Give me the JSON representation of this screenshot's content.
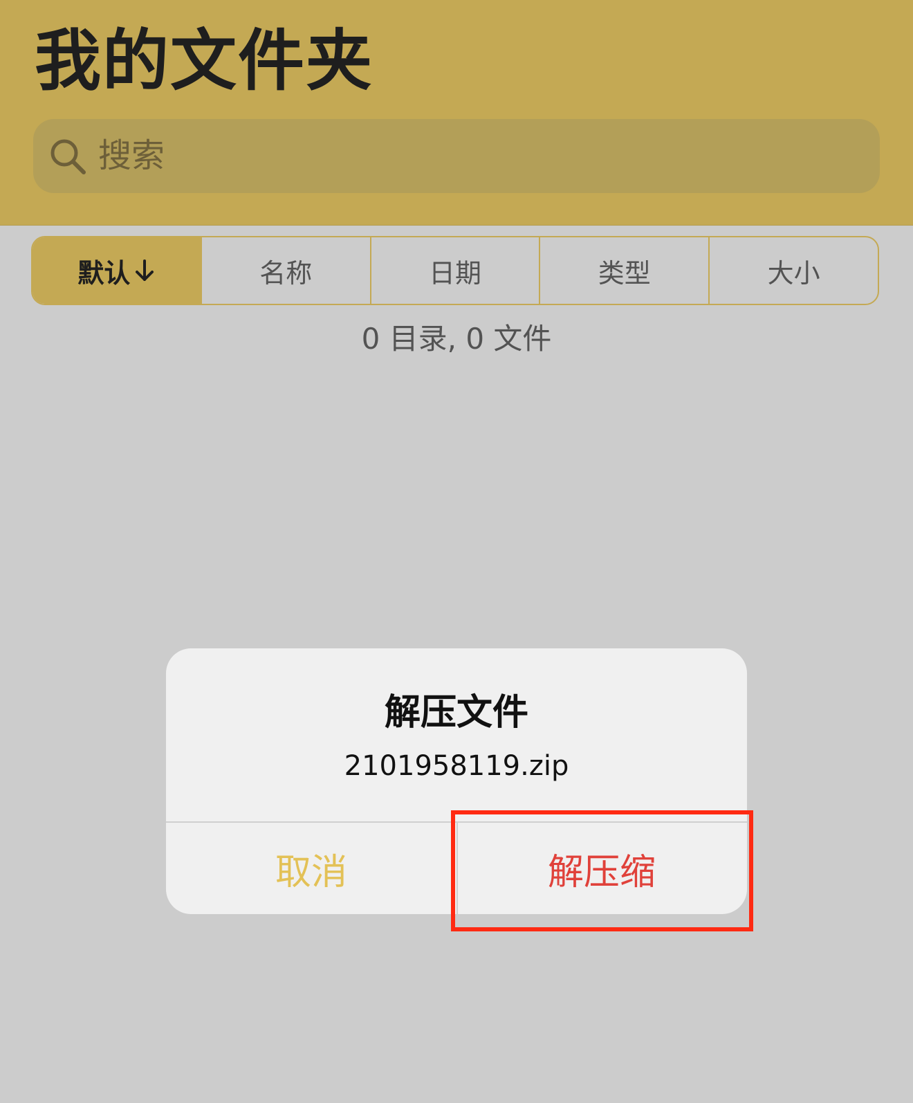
{
  "header": {
    "title": "我的文件夹",
    "search": {
      "placeholder": "搜索"
    }
  },
  "sort": {
    "tabs": [
      {
        "label": "默认"
      },
      {
        "label": "名称"
      },
      {
        "label": "日期"
      },
      {
        "label": "类型"
      },
      {
        "label": "大小"
      }
    ],
    "active_index": 0,
    "active_direction_icon": "arrow-down-icon"
  },
  "summary": "0 目录, 0 文件",
  "dialog": {
    "title": "解压文件",
    "message": "2101958119.zip",
    "cancel_label": "取消",
    "confirm_label": "解压缩"
  },
  "colors": {
    "header_bg": "#c4a954",
    "page_bg": "#cccccc",
    "cancel": "#e3c156",
    "confirm": "#e0413a",
    "highlight": "#ff2a12"
  }
}
